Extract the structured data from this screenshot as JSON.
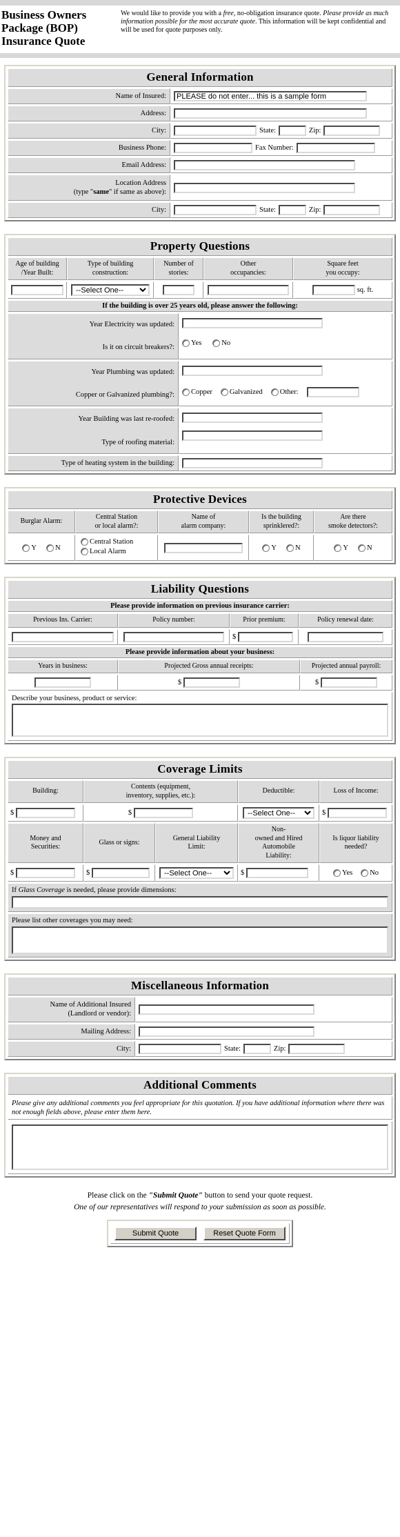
{
  "header": {
    "title_lines": [
      "Business Owners",
      "Package (BOP)",
      "Insurance Quote"
    ],
    "intro_pre": "We would like to provide you with a ",
    "intro_free": "free",
    "intro_mid": ", no-obligation insurance quote. ",
    "intro_em": "Please provide as much information possible for the most accurate quote",
    "intro_post": ". This information will be kept confidential and will be used for quote purposes only."
  },
  "general": {
    "title": "General Information",
    "name_label": "Name of Insured:",
    "name_value": "PLEASE do not enter... this is a sample form",
    "address_label": "Address:",
    "address_value": "",
    "city_label": "City:",
    "city_value": "",
    "state_label": "State:",
    "state_value": "",
    "zip_label": "Zip:",
    "zip_value": "",
    "phone_label": "Business Phone:",
    "phone_value": "",
    "fax_label": "Fax Number:",
    "fax_value": "",
    "email_label": "Email Address:",
    "email_value": "",
    "loc_label_l1": "Location Address",
    "loc_label_l2_pre": "(type \"",
    "loc_label_same": "same",
    "loc_label_l2_post": "\" if same as above):",
    "loc_value": "",
    "loc_city_label": "City:",
    "loc_city_value": "",
    "loc_state_label": "State:",
    "loc_state_value": "",
    "loc_zip_label": "Zip:",
    "loc_zip_value": ""
  },
  "property": {
    "title": "Property Questions",
    "headers": [
      "Age of building\n/Year Built:",
      "Type of building\nconstruction:",
      "Number of\nstories:",
      "Other\noccupancies:",
      "Square feet\nyou occupy:"
    ],
    "age_value": "",
    "construction_selected": "--Select One--",
    "construction_options": [
      "--Select One--"
    ],
    "stories_value": "",
    "occupancies_value": "",
    "sqft_value": "",
    "sqft_suffix": "sq. ft.",
    "subheader": "If the building is over 25 years old, please answer the following:",
    "electricity_label": "Year Electricity was updated:",
    "electricity_value": "",
    "breakers_label": "Is it on circuit breakers?:",
    "breakers_opt_yes": "Yes",
    "breakers_opt_no": "No",
    "plumbing_label": "Year Plumbing was updated:",
    "plumbing_value": "",
    "pipe_label": "Copper or Galvanized plumbing?:",
    "pipe_opt_copper": "Copper",
    "pipe_opt_galvanized": "Galvanized",
    "pipe_opt_other": "Other:",
    "pipe_other_value": "",
    "reroof_label": "Year Building was last re-roofed:",
    "reroof_value": "",
    "roof_material_label": "Type of roofing material:",
    "roof_material_value": "",
    "heating_label": "Type of heating system in the building:",
    "heating_value": ""
  },
  "protective": {
    "title": "Protective Devices",
    "headers": [
      "Burglar Alarm:",
      "Central Station\nor local alarm?:",
      "Name of\nalarm company:",
      "Is the building\nsprinklered?:",
      "Are there\nsmoke detectors?:"
    ],
    "burglar_y": "Y",
    "burglar_n": "N",
    "alarm_opt_central": "Central Station",
    "alarm_opt_local": "Local Alarm",
    "company_value": "",
    "sprinkler_y": "Y",
    "sprinkler_n": "N",
    "smoke_y": "Y",
    "smoke_n": "N"
  },
  "liability": {
    "title": "Liability Questions",
    "sub1": "Please provide information on previous insurance carrier:",
    "carrier_header": "Previous Ins. Carrier:",
    "carrier_value": "",
    "policy_header": "Policy number:",
    "policy_value": "",
    "premium_header": "Prior premium:",
    "premium_prefix": "$",
    "premium_value": "",
    "renewal_header": "Policy renewal date:",
    "renewal_value": "",
    "sub2": "Please provide information about your business:",
    "years_header": "Years in business:",
    "years_value": "",
    "receipts_header": "Projected Gross annual receipts:",
    "receipts_prefix": "$",
    "receipts_value": "",
    "payroll_header": "Projected annual payroll:",
    "payroll_prefix": "$",
    "payroll_value": "",
    "describe_label": "Describe your business, product or service:",
    "describe_value": ""
  },
  "coverage": {
    "title": "Coverage Limits",
    "building_header": "Building:",
    "building_prefix": "$",
    "building_value": "",
    "contents_header": "Contents (equipment,\ninventory, supplies, etc.):",
    "contents_prefix": "$",
    "contents_value": "",
    "deductible_header": "Deductible:",
    "deductible_selected": "--Select One--",
    "deductible_options": [
      "--Select One--"
    ],
    "loss_header": "Loss of Income:",
    "loss_prefix": "$",
    "loss_value": "",
    "money_header": "Money and\nSecurities:",
    "money_prefix": "$",
    "money_value": "",
    "glass_header": "Glass or signs:",
    "glass_prefix": "$",
    "glass_value": "",
    "gl_header": "General Liability\nLimit:",
    "gl_selected": "--Select One--",
    "gl_options": [
      "--Select One--"
    ],
    "auto_header": "Non-\nowned and Hired\nAutomobile\nLiability:",
    "auto_prefix": "$",
    "auto_value": "",
    "liquor_header": "Is liquor liability\nneeded?",
    "liquor_yes": "Yes",
    "liquor_no": "No",
    "glass_dim_pre": "If ",
    "glass_dim_em": "Glass Coverage",
    "glass_dim_post": " is needed, please provide dimensions:",
    "glass_dim_value": "",
    "other_cov_label": "Please list other coverages you may need:",
    "other_cov_value": ""
  },
  "misc": {
    "title": "Miscellaneous Information",
    "addl_label_l1": "Name of Additional Insured",
    "addl_label_l2": "(Landlord or vendor):",
    "addl_value": "",
    "mailing_label": "Mailing Address:",
    "mailing_value": "",
    "city_label": "City:",
    "city_value": "",
    "state_label": "State:",
    "state_value": "",
    "zip_label": "Zip:",
    "zip_value": ""
  },
  "comments": {
    "title": "Additional Comments",
    "instructions": "Please give any additional comments you feel appropriate for this quotation. If you have additional information where there was not enough fields above, please enter them here.",
    "value": ""
  },
  "footer": {
    "line1_pre": "Please click on the ",
    "line1_em": "\"Submit Quote\"",
    "line1_post": " button to send your quote request.",
    "line2": "One of our representatives will respond to your submission as soon as possible.",
    "submit_label": "Submit Quote",
    "reset_label": "Reset Quote Form"
  }
}
